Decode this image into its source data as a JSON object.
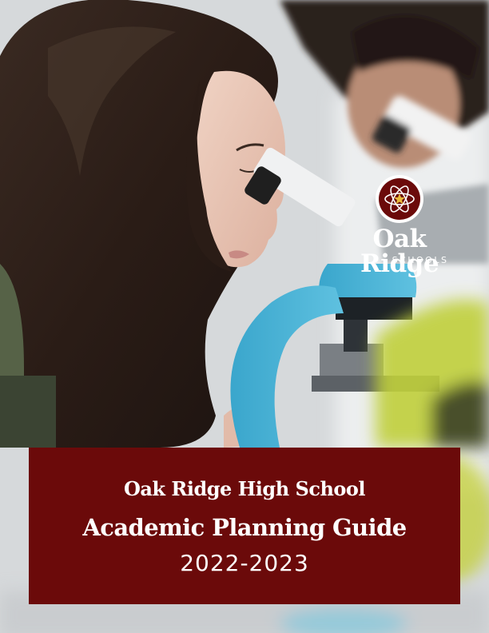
{
  "cover": {
    "logo": {
      "name": "Oak Ridge",
      "subtitle": "SCHOOLS",
      "seal_icon": "atom-star-seal-icon"
    },
    "school_name": "Oak Ridge High School",
    "guide_title": "Academic Planning Guide",
    "year": "2022-2023"
  },
  "colors": {
    "maroon": "#6b0a0a",
    "microscope_blue": "#4ab3d6",
    "accent_green": "#b7c83a"
  }
}
